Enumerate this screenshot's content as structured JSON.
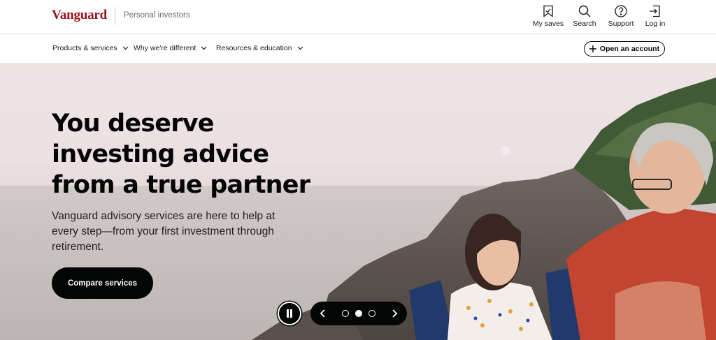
{
  "header": {
    "logo": "Vanguard",
    "segment": "Personal investors",
    "utilities": [
      {
        "label": "My saves",
        "icon": "bookmark-icon"
      },
      {
        "label": "Search",
        "icon": "search-icon"
      },
      {
        "label": "Support",
        "icon": "help-circle-icon"
      },
      {
        "label": "Log in",
        "icon": "login-icon"
      }
    ]
  },
  "nav": {
    "items": [
      {
        "label": "Products & services"
      },
      {
        "label": "Why we're different"
      },
      {
        "label": "Resources & education"
      }
    ],
    "open_account_label": "Open an account"
  },
  "hero": {
    "headline": "You deserve investing advice from a true partner",
    "subtext": "Vanguard advisory services are here to help at every step—from your first investment through retirement.",
    "cta_label": "Compare services"
  },
  "carousel": {
    "current_slide": 2,
    "total_slides": 3,
    "paused": false
  },
  "colors": {
    "brand": "#96151d",
    "ink": "#040505"
  }
}
